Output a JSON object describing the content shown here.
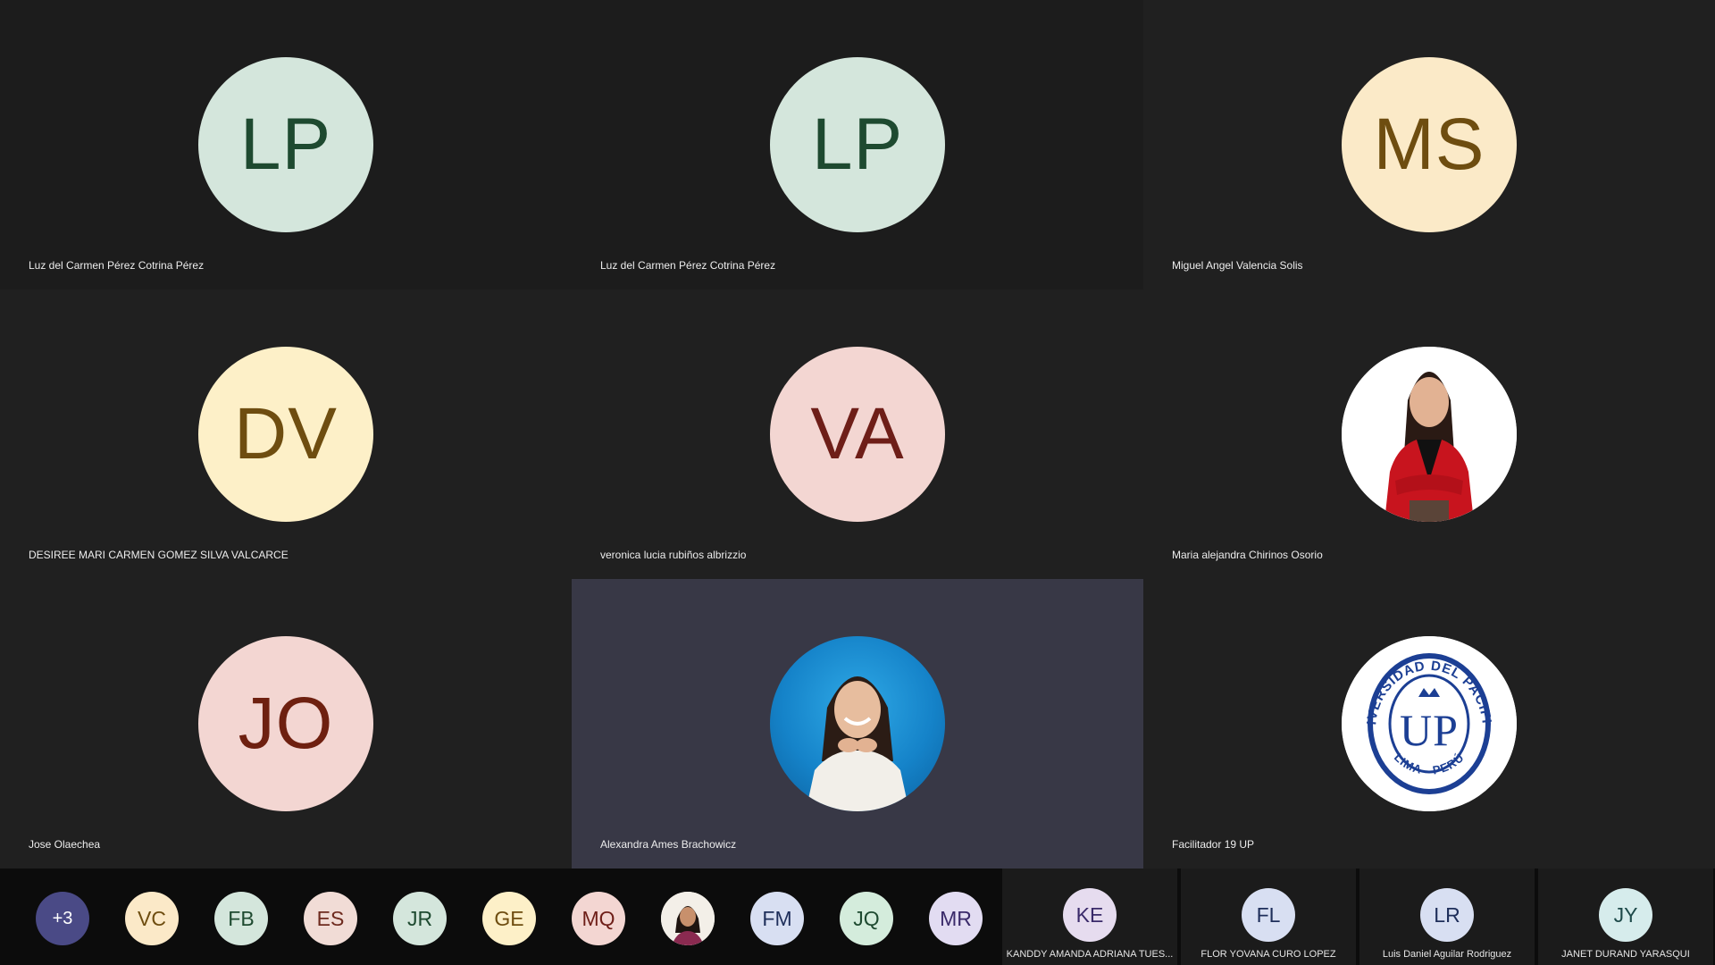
{
  "tiles": [
    {
      "initials": "LP",
      "name": "Luz del Carmen Pérez Cotrina Pérez",
      "bg": "#d4e6dc",
      "fg": "#1e4a30"
    },
    {
      "initials": "LP",
      "name": "Luz del Carmen Pérez Cotrina Pérez",
      "bg": "#d4e6dc",
      "fg": "#1e4a30"
    },
    {
      "initials": "MS",
      "name": "Miguel Angel Valencia Solis",
      "bg": "#fbeac8",
      "fg": "#6e4d10"
    },
    {
      "initials": "DV",
      "name": "DESIREE MARI CARMEN GOMEZ SILVA VALCARCE",
      "bg": "#fdf0c8",
      "fg": "#6e4d10"
    },
    {
      "initials": "VA",
      "name": "veronica lucia rubiños albrizzio",
      "bg": "#f3d6d2",
      "fg": "#6e1e18"
    },
    {
      "initials": "",
      "name": "Maria alejandra Chirinos Osorio",
      "bg": "#ffffff",
      "fg": "#000000",
      "photo": "woman-red-blazer"
    },
    {
      "initials": "JO",
      "name": "Jose Olaechea",
      "bg": "#f3d6d2",
      "fg": "#6e2010"
    },
    {
      "initials": "",
      "name": "Alexandra Ames Brachowicz",
      "bg": "#1583c9",
      "fg": "#ffffff",
      "photo": "woman-blue-background"
    },
    {
      "initials": "",
      "name": "Facilitador 19 UP",
      "bg": "#ffffff",
      "fg": "#1c3f94",
      "photo": "universidad-del-pacifico-seal",
      "seal_text_top": "UNIVERSIDAD DEL PACIFICO",
      "seal_text_bottom": "LIMA - PERÚ",
      "seal_monogram": "UP"
    }
  ],
  "strip": {
    "more_label": "+3",
    "avatars": [
      {
        "initials": "VC",
        "bg": "#fbe9c8",
        "fg": "#6e4d10"
      },
      {
        "initials": "FB",
        "bg": "#d4e6dc",
        "fg": "#1e4a30"
      },
      {
        "initials": "ES",
        "bg": "#f1dcd6",
        "fg": "#6e2a1e"
      },
      {
        "initials": "JR",
        "bg": "#d4e6dc",
        "fg": "#1e4a30"
      },
      {
        "initials": "GE",
        "bg": "#fdf0c8",
        "fg": "#6e4d10"
      },
      {
        "initials": "MQ",
        "bg": "#f3d6d2",
        "fg": "#6e1e18"
      },
      {
        "initials": "",
        "bg": "#f3efe8",
        "fg": "#333333",
        "photo": "woman-small-photo"
      },
      {
        "initials": "FM",
        "bg": "#d8dff2",
        "fg": "#1e2e5a"
      },
      {
        "initials": "JQ",
        "bg": "#d4ecdc",
        "fg": "#1e4a30"
      },
      {
        "initials": "MR",
        "bg": "#e2dcf2",
        "fg": "#3a2a6a"
      }
    ],
    "named": [
      {
        "initials": "KE",
        "name": "KANDDY  AMANDA  ADRIANA TUES...",
        "bg": "#e6dcef",
        "fg": "#3a2a6a"
      },
      {
        "initials": "FL",
        "name": "FLOR YOVANA CURO LOPEZ",
        "bg": "#d8dff2",
        "fg": "#1e2e5a"
      },
      {
        "initials": "LR",
        "name": "Luis Daniel Aguilar Rodriguez",
        "bg": "#d8dff2",
        "fg": "#1e2e5a"
      },
      {
        "initials": "JY",
        "name": "JANET  DURAND YARASQUI",
        "bg": "#d6ecec",
        "fg": "#1e4a4a"
      }
    ]
  }
}
